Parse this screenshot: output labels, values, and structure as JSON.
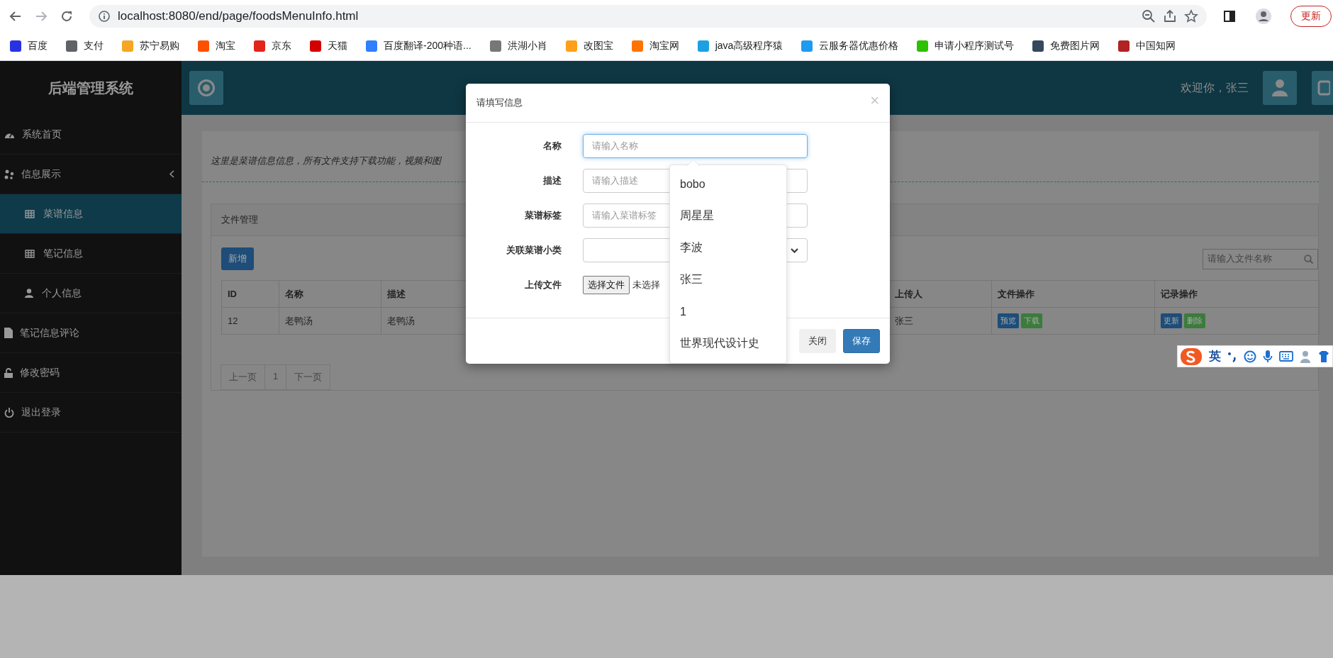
{
  "browser": {
    "url": "localhost:8080/end/page/foodsMenuInfo.html",
    "update_button": "更新",
    "bookmarks": [
      {
        "label": "百度",
        "color": "#2932e1"
      },
      {
        "label": "支付",
        "color": "#5f6368"
      },
      {
        "label": "苏宁易购",
        "color": "#f5a623"
      },
      {
        "label": "淘宝",
        "color": "#ff5000"
      },
      {
        "label": "京东",
        "color": "#e1251b"
      },
      {
        "label": "天猫",
        "color": "#d40000"
      },
      {
        "label": "百度翻译-200种语...",
        "color": "#2f7fff"
      },
      {
        "label": "洪湖小肖",
        "color": "#777777"
      },
      {
        "label": "改图宝",
        "color": "#ff9f1a"
      },
      {
        "label": "淘宝网",
        "color": "#ff7300"
      },
      {
        "label": "java高级程序猿",
        "color": "#1ba1e2"
      },
      {
        "label": "云服务器优惠价格",
        "color": "#1e9bf0"
      },
      {
        "label": "申请小程序测试号",
        "color": "#2dc100"
      },
      {
        "label": "免费图片网",
        "color": "#34495e"
      },
      {
        "label": "中国知网",
        "color": "#b22222"
      }
    ]
  },
  "sidebar": {
    "title": "后端管理系统",
    "items": [
      {
        "label": "系统首页",
        "selected": false
      },
      {
        "label": "信息展示",
        "selected": false,
        "expanded": true,
        "children": [
          {
            "label": "菜谱信息",
            "selected": true
          },
          {
            "label": "笔记信息",
            "selected": false
          },
          {
            "label": "个人信息",
            "selected": false
          }
        ]
      },
      {
        "label": "笔记信息评论",
        "selected": false
      },
      {
        "label": "修改密码",
        "selected": false
      },
      {
        "label": "退出登录",
        "selected": false
      }
    ]
  },
  "header": {
    "welcome": "欢迎你，张三"
  },
  "content": {
    "intro": "这里是菜谱信息信息，所有文件支持下载功能，视频和图",
    "panel_title": "文件管理",
    "add_button": "新增",
    "search": {
      "placeholder": "请输入文件名称"
    },
    "table": {
      "columns": [
        "ID",
        "名称",
        "描述",
        "上传人",
        "文件操作",
        "记录操作"
      ],
      "rows": [
        {
          "cells": [
            "12",
            "老鸭汤",
            "老鸭汤",
            "张三"
          ],
          "file_actions": [
            "预览",
            "下载"
          ],
          "record_actions": [
            "更新",
            "删除"
          ]
        }
      ]
    },
    "pagination": {
      "prev": "上一页",
      "pages": [
        "1"
      ],
      "next": "下一页"
    }
  },
  "dialog": {
    "title": "请填写信息",
    "close": "×",
    "fields": [
      {
        "kind": "text",
        "label": "名称",
        "placeholder": "请输入名称",
        "focused": true
      },
      {
        "kind": "text",
        "label": "描述",
        "placeholder": "请输入描述",
        "focused": false
      },
      {
        "kind": "text",
        "label": "菜谱标签",
        "placeholder": "请输入菜谱标签",
        "focused": false
      },
      {
        "kind": "select",
        "label": "关联菜谱小类"
      },
      {
        "kind": "file",
        "label": "上传文件",
        "button": "选择文件",
        "status": "未选择"
      }
    ],
    "buttons": [
      {
        "label": "关闭",
        "kind": "default"
      },
      {
        "label": "保存",
        "kind": "primary"
      }
    ],
    "suggestions": [
      "bobo",
      "周星星",
      "李波",
      "张三",
      "1",
      "世界现代设计史"
    ]
  },
  "ime": {
    "mode": "英"
  }
}
